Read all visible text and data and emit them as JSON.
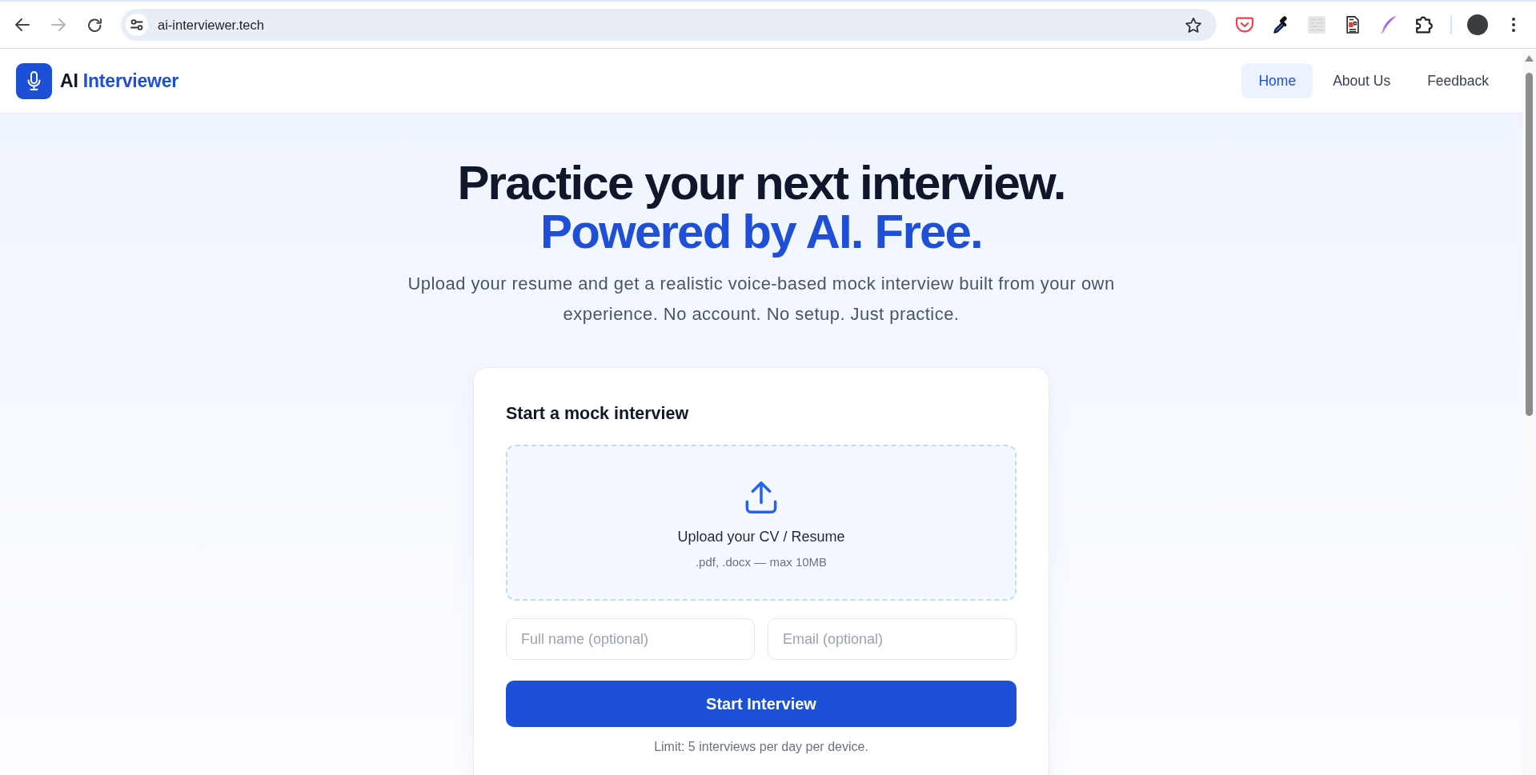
{
  "browser": {
    "url": "ai-interviewer.tech",
    "forward": {
      "disabled": true
    }
  },
  "header": {
    "logo": {
      "text": "AI",
      "accent": "Interviewer"
    },
    "nav": [
      {
        "label": "Home",
        "selected": true
      },
      {
        "label": "About Us",
        "selected": false
      },
      {
        "label": "Feedback",
        "selected": false
      }
    ]
  },
  "hero": {
    "headline": "Practice your next interview.",
    "tagline": "Powered by AI. Free.",
    "description": "Upload your resume and get a realistic voice-based mock interview built from your own experience. No account. No setup. Just practice."
  },
  "card": {
    "title": "Start a mock interview",
    "upload": {
      "label": "Upload your CV / Resume",
      "hint": ".pdf, .docx — max 10MB"
    },
    "fields": [
      {
        "placeholder": "Full name (optional)"
      },
      {
        "placeholder": "Email (optional)"
      }
    ],
    "button": "Start Interview",
    "note": "Limit: 5 interviews per day per device."
  }
}
